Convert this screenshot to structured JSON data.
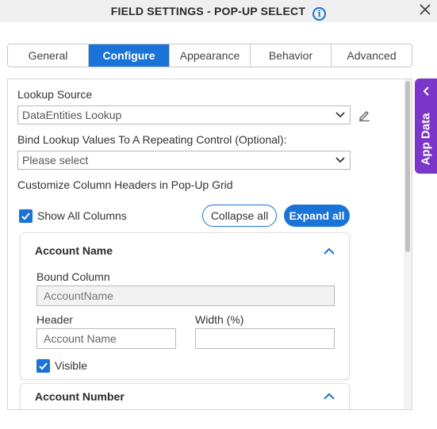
{
  "header": {
    "title": "FIELD SETTINGS - POP-UP SELECT",
    "info_glyph": "i"
  },
  "tabs": [
    {
      "label": "General",
      "active": false
    },
    {
      "label": "Configure",
      "active": true
    },
    {
      "label": "Appearance",
      "active": false
    },
    {
      "label": "Behavior",
      "active": false
    },
    {
      "label": "Advanced",
      "active": false
    }
  ],
  "configure": {
    "lookup_source_label": "Lookup Source",
    "lookup_source_value": "DataEntities Lookup",
    "bind_label": "Bind Lookup Values To A Repeating Control (Optional):",
    "bind_placeholder": "Please select",
    "customize_label": "Customize Column Headers in Pop-Up Grid",
    "show_all_label": "Show All Columns",
    "show_all_checked": true,
    "collapse_all": "Collapse all",
    "expand_all": "Expand all"
  },
  "columns": [
    {
      "title": "Account Name",
      "bound_column_label": "Bound Column",
      "bound_column_value": "AccountName",
      "header_label": "Header",
      "header_placeholder": "Account Name",
      "width_label": "Width (%)",
      "width_value": "",
      "visible_label": "Visible",
      "visible_checked": true
    },
    {
      "title": "Account Number"
    }
  ],
  "side_panel": {
    "label": "App Data"
  },
  "colors": {
    "accent": "#1a73d6",
    "side_panel": "#7b35c9",
    "header_bg": "#efefef"
  }
}
